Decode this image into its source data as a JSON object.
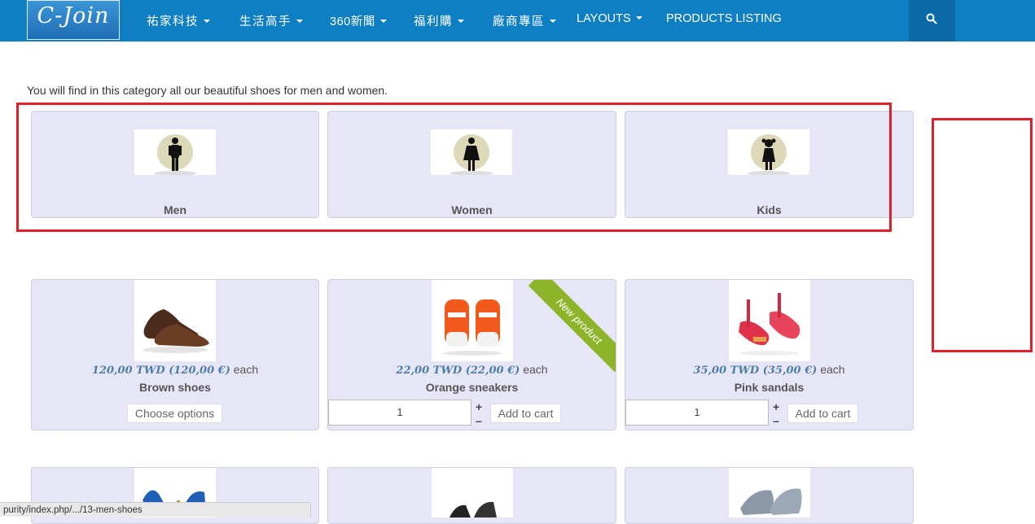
{
  "navbar": {
    "logo_text": "C-Join",
    "items": [
      {
        "label": "祐家科技"
      },
      {
        "label": "生活高手"
      },
      {
        "label": "360新聞"
      },
      {
        "label": "福利購"
      },
      {
        "label": "廠商專區"
      },
      {
        "label": "LAYOUTS"
      },
      {
        "label": "PRODUCTS LISTING"
      }
    ],
    "search_icon": "search-icon",
    "color": "#0f7fc4"
  },
  "intro": "You will find in this category all our beautiful shoes for men and women.",
  "categories": [
    {
      "name": "Men",
      "icon": "man-icon"
    },
    {
      "name": "Women",
      "icon": "woman-icon"
    },
    {
      "name": "Kids",
      "icon": "child-icon"
    }
  ],
  "products": [
    {
      "price": "120,00 TWD (120,00 €)",
      "each": "each",
      "name": "Brown shoes",
      "button": "Choose options"
    },
    {
      "price": "22,00 TWD (22,00 €)",
      "each": "each",
      "name": "Orange sneakers",
      "qty": "1",
      "plus": "+",
      "minus": "–",
      "button": "Add to cart",
      "ribbon": "New product"
    },
    {
      "price": "35,00 TWD (35,00 €)",
      "each": "each",
      "name": "Pink sandals",
      "qty": "1",
      "plus": "+",
      "minus": "–",
      "button": "Add to cart"
    }
  ],
  "status_bar": "purity/index.php/.../13-men-shoes",
  "colors": {
    "card_bg": "#e7e6f7",
    "price": "#4b7ea8",
    "highlight": "#e0202a",
    "ribbon": "#8cb52a"
  }
}
